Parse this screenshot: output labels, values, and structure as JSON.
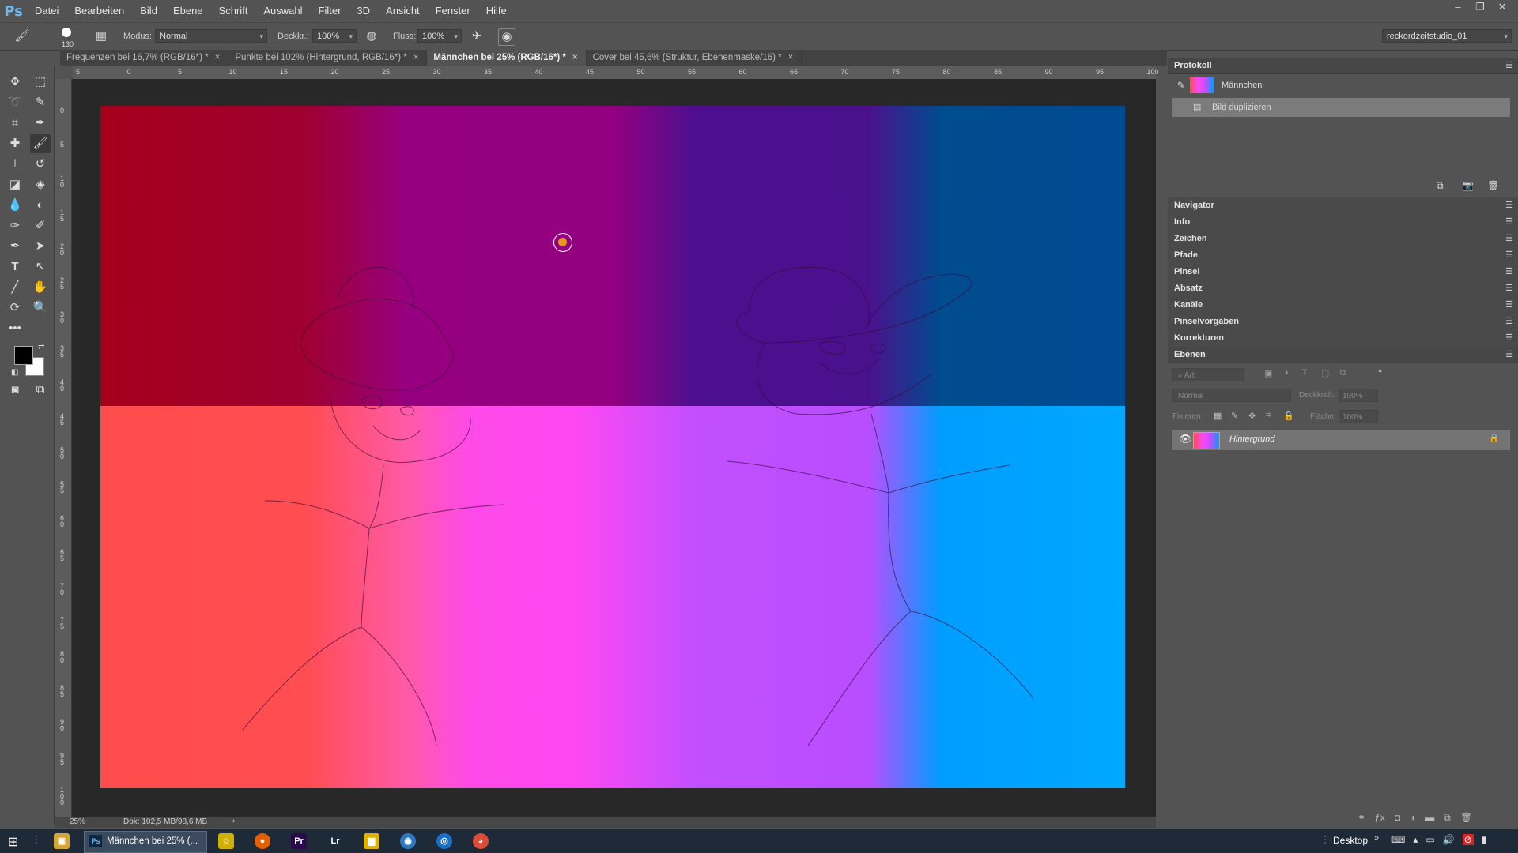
{
  "app": {
    "logo": "Ps"
  },
  "menu": [
    "Datei",
    "Bearbeiten",
    "Bild",
    "Ebene",
    "Schrift",
    "Auswahl",
    "Filter",
    "3D",
    "Ansicht",
    "Fenster",
    "Hilfe"
  ],
  "window_controls": [
    "–",
    "❐",
    "✕"
  ],
  "options": {
    "brush_size": "130",
    "mode_label": "Modus:",
    "mode_value": "Normal",
    "opacity_label": "Deckkr.:",
    "opacity_value": "100%",
    "flow_label": "Fluss:",
    "flow_value": "100%",
    "workspace_value": "reckordzeitstudio_01"
  },
  "tabs": [
    {
      "label": "Frequenzen bei 16,7% (RGB/16*) *",
      "active": false
    },
    {
      "label": "Punkte bei 102% (Hintergrund, RGB/16*) *",
      "active": false
    },
    {
      "label": "Männchen bei 25% (RGB/16*) *",
      "active": true
    },
    {
      "label": "Cover bei 45,6% (Struktur, Ebenenmaske/16) *",
      "active": false
    }
  ],
  "tab_close": "×",
  "ruler_top": [
    "5",
    "0",
    "5",
    "10",
    "15",
    "20",
    "25",
    "30",
    "35",
    "40",
    "45",
    "50",
    "55",
    "60",
    "65",
    "70",
    "75",
    "80",
    "85",
    "90",
    "95",
    "100"
  ],
  "ruler_left": [
    "0",
    "5",
    "1 0",
    "1 5",
    "2 0",
    "2 5",
    "3 0",
    "3 5",
    "4 0",
    "4 5",
    "5 0",
    "5 5",
    "6 0",
    "6 5",
    "7 0",
    "7 5",
    "8 0",
    "8 5",
    "9 0",
    "9 5",
    "1 0 0"
  ],
  "status": {
    "zoom": "25%",
    "doc": "Dok: 102,5 MB/98,6 MB",
    "arrow": "›"
  },
  "panels": {
    "protokoll": {
      "title": "Protokoll",
      "items": [
        {
          "label": "Männchen",
          "selected": false
        },
        {
          "label": "Bild duplizieren",
          "selected": true
        }
      ]
    },
    "collapsed": [
      "Navigator",
      "Info",
      "Zeichen",
      "Pfade",
      "Pinsel",
      "Absatz",
      "Kanäle",
      "Pinselvorgaben",
      "Korrekturen"
    ],
    "ebenen": {
      "title": "Ebenen",
      "filter_placeholder": "Art",
      "blend_mode": "Normal",
      "opacity_label": "Deckkraft:",
      "opacity_value": "100%",
      "lock_label": "Fixieren:",
      "fill_label": "Fläche:",
      "fill_value": "100%",
      "layers": [
        {
          "name": "Hintergrund",
          "visible": true,
          "locked": true
        }
      ]
    }
  },
  "taskbar": {
    "active_app_label": "Männchen bei 25% (...",
    "desktop_label": "Desktop",
    "apps": [
      {
        "name": "Explorer",
        "color": "#d6a634",
        "glyph": "▣"
      },
      {
        "name": "Photoshop",
        "color": "#0a2744",
        "glyph": "Ps"
      },
      {
        "name": "Tool",
        "color": "#d1b000",
        "glyph": "☺"
      },
      {
        "name": "Firefox",
        "color": "#e66000",
        "glyph": "●"
      },
      {
        "name": "Premiere",
        "color": "#2a0a4a",
        "glyph": "Pr"
      },
      {
        "name": "Lightroom",
        "color": "#1c2b3a",
        "glyph": "Lr"
      },
      {
        "name": "Folder",
        "color": "#e2b200",
        "glyph": "▆"
      },
      {
        "name": "App",
        "color": "#2f78c4",
        "glyph": "◉"
      },
      {
        "name": "Safari",
        "color": "#1a6ec8",
        "glyph": "◎"
      },
      {
        "name": "Chrome",
        "color": "#dd4b39",
        "glyph": "◕"
      }
    ]
  },
  "colors": {
    "foreground": "#000000",
    "background": "#ffffff",
    "brush_cursor": "#e8961e"
  }
}
